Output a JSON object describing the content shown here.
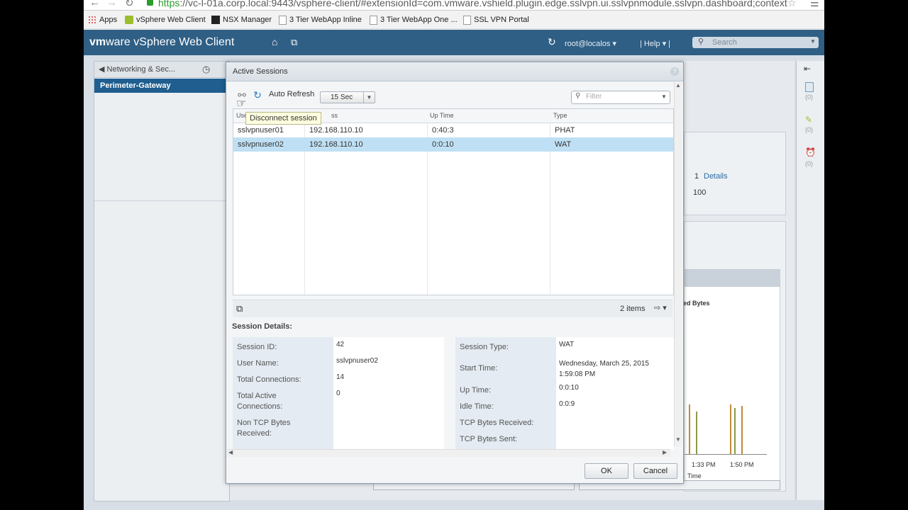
{
  "browser": {
    "url_scheme": "https",
    "url_rest": "://vc-l-01a.corp.local:9443/vsphere-client/#extensionId=com.vmware.vshield.plugin.edge.sslvpn.ui.sslvpnmodule.sslvpn.dashboard;context=",
    "bookmarks": [
      {
        "label": "Apps",
        "icon": "apps-grid-icon"
      },
      {
        "label": "vSphere Web Client",
        "icon": "vsphere-icon"
      },
      {
        "label": "NSX Manager",
        "icon": "nsx-icon"
      },
      {
        "label": "3 Tier WebApp Inline",
        "icon": "page-icon"
      },
      {
        "label": "3 Tier WebApp One ...",
        "icon": "page-icon"
      },
      {
        "label": "SSL VPN Portal",
        "icon": "page-icon"
      }
    ]
  },
  "header": {
    "logo_vm": "vm",
    "logo_ware": "ware",
    "product": "vSphere Web Client",
    "user": "root@localos",
    "help": "Help",
    "search_placeholder": "Search"
  },
  "nav": {
    "breadcrumb": "Networking & Sec...",
    "selected": "Perimeter-Gateway"
  },
  "background": {
    "details_count": "1",
    "details_link": "Details",
    "value_100": "100",
    "received_bytes": "ed Bytes",
    "time_labels": [
      "1:33 PM",
      "1:50 PM"
    ],
    "time_axis": "Time",
    "strip_counts": [
      "(0)",
      "(0)",
      "(0)"
    ]
  },
  "modal": {
    "title": "Active Sessions",
    "toolbar": {
      "auto_refresh_label": "Auto Refresh",
      "refresh_interval": "15 Sec",
      "filter_placeholder": "Filter"
    },
    "tooltip": "Disconnect session",
    "grid": {
      "columns": [
        "User",
        "ss",
        "Up Time",
        "Type"
      ],
      "rows": [
        {
          "user": "sslvpnuser01",
          "ip": "192.168.110.10",
          "uptime": "0:40:3",
          "type": "PHAT"
        },
        {
          "user": "sslvpnuser02",
          "ip": "192.168.110.10",
          "uptime": "0:0:10",
          "type": "WAT"
        }
      ],
      "item_count": "2 items"
    },
    "details": {
      "section_label": "Session Details:",
      "left": [
        {
          "label": "Session ID:",
          "value": "42"
        },
        {
          "label": "User Name:",
          "value": "sslvpnuser02"
        },
        {
          "label": "Total Connections:",
          "value": "14"
        },
        {
          "label": "Total Active Connections:",
          "value": "0"
        },
        {
          "label": "Non TCP Bytes Received:",
          "value": ""
        }
      ],
      "right": [
        {
          "label": "Session Type:",
          "value": "WAT"
        },
        {
          "label": "Start Time:",
          "value": "Wednesday, March 25, 2015 1:59:08 PM"
        },
        {
          "label": "Up Time:",
          "value": "0:0:10"
        },
        {
          "label": "Idle Time:",
          "value": "0:0:9"
        },
        {
          "label": "TCP Bytes Received:",
          "value": ""
        },
        {
          "label": "TCP Bytes Sent:",
          "value": ""
        }
      ]
    },
    "ok_label": "OK",
    "cancel_label": "Cancel"
  },
  "colors": {
    "header_bg": "#2f5f85",
    "selected_row": "#bfe0f4",
    "nav_selected": "#1f5e8f"
  }
}
